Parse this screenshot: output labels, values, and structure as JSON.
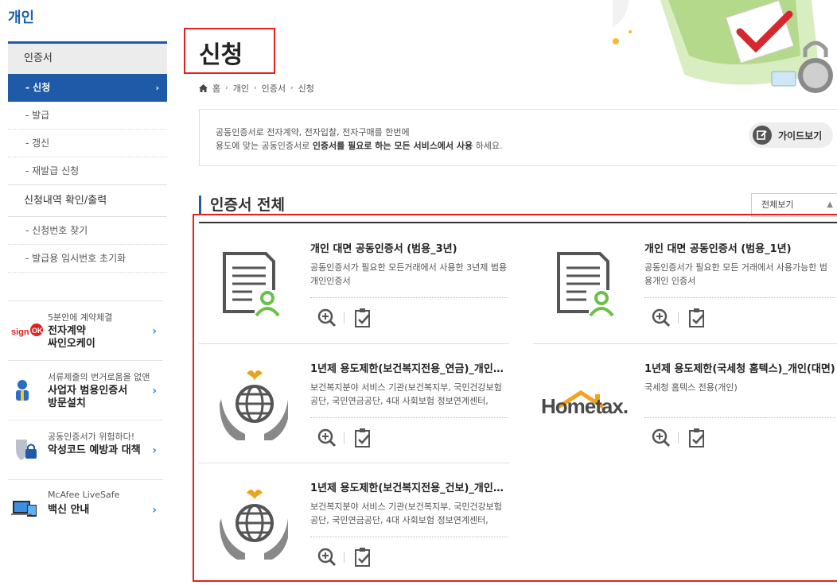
{
  "brand": "개인",
  "sidebar": {
    "heading": "인증서",
    "items": [
      {
        "label": "- 신청",
        "active": true
      },
      {
        "label": "- 발급"
      },
      {
        "label": "- 갱신"
      },
      {
        "label": "- 재발급 신청"
      }
    ],
    "category2": "신청내역 확인/출력",
    "items2": [
      {
        "label": "- 신청번호 찾기"
      },
      {
        "label": "- 발급용 임시번호 초기화"
      }
    ],
    "chevron": "›"
  },
  "promos": [
    {
      "small": "5분안에 계약체결",
      "line1": "전자계약",
      "line2": "싸인오케이",
      "icon": "signok-logo-icon",
      "arrow": "›"
    },
    {
      "small": "서류제출의 번거로움을 없앤",
      "line1": "사업자 범용인증서",
      "line2": "방문설치",
      "icon": "visiting-agent-icon",
      "arrow": "›"
    },
    {
      "small": "공동인증서가 위험하다!",
      "line1": "악성코드 예방과 대책",
      "line2": "",
      "icon": "shield-lock-icon",
      "arrow": "›"
    },
    {
      "small": "McAfee LiveSafe",
      "line1": "백신 안내",
      "line2": "",
      "icon": "mcafee-devices-icon",
      "arrow": "›"
    }
  ],
  "page": {
    "title": "신청",
    "breadcrumb": [
      "홈",
      "개인",
      "인증서",
      "신청"
    ]
  },
  "info": {
    "line1": "공동인증서로 전자계약, 전자입찰, 전자구매를 한번에",
    "line2_pre": "용도에 맞는 공동인증서로 ",
    "line2_bold": "인증서를 필요로 하는 모든 서비스에서 사용",
    "line2_post": " 하세요.",
    "guide_button": "가이드보기"
  },
  "section": {
    "title": "인증서 전체",
    "view_select": "전체보기"
  },
  "cards": [
    {
      "title": "개인 대면 공동인증서 (범용_3년)",
      "desc": "공동인증서가 필요한 모든거래에서 사용한 3년제 범용개인인증서",
      "icon": "document-person-icon"
    },
    {
      "title": "개인 대면 공동인증서 (범용_1년)",
      "desc": "공동인증서가 필요한 모든 거래에서 사용가능한 범용개인 인증서",
      "icon": "document-person-icon"
    },
    {
      "title": "1년제 용도제한(보건복지전용_연금)_개인…",
      "desc": "보건복지분야 서비스 기관(보건복지부, 국민건강보험공단, 국민연금공단, 4대 사회보험 정보연계센터,",
      "icon": "globe-hands-icon"
    },
    {
      "title": "1년제 용도제한(국세청 홈텍스)_개인(대면)",
      "desc": "국세청 홈텍스 전용(개인)",
      "icon": "hometax-logo-icon",
      "logo_text": "Hometax."
    },
    {
      "title": "1년제 용도제한(보건복지전용_건보)_개인…",
      "desc": "보건복지분야 서비스 기관(보건복지부, 국민건강보험공단, 국민연금공단, 4대 사회보험 정보연계센터,",
      "icon": "globe-hands-icon"
    }
  ],
  "colors": {
    "accent": "#1e5aa8",
    "highlight": "#e52020",
    "promo_arrow": "#2a8bd6"
  }
}
